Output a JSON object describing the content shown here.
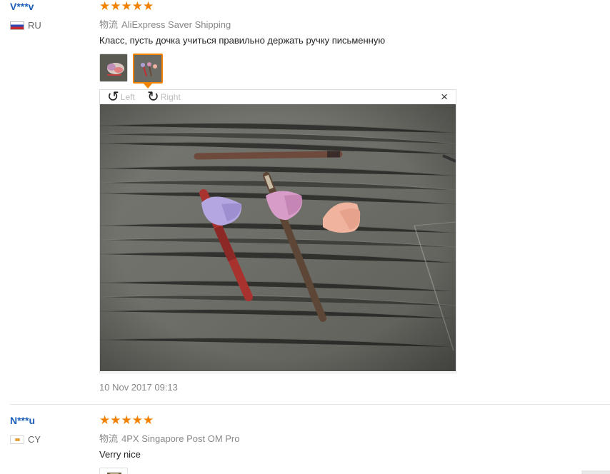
{
  "reviews": [
    {
      "user": "V***v",
      "country": "RU",
      "stars": "★★★★★",
      "rating": 5,
      "shipping_label": "物流",
      "shipping": "AliExpress Saver Shipping",
      "text": "Класс, пусть дочка учиться правильно держать ручку письменную",
      "viewer": {
        "left_label": "Left",
        "right_label": "Right",
        "close": "×"
      },
      "date": "10 Nov 2017 09:13"
    },
    {
      "user": "N***u",
      "country": "CY",
      "stars": "★★★★★",
      "rating": 5,
      "shipping_label": "物流",
      "shipping": "4PX Singapore Post OM Pro",
      "text": "Verry nice"
    }
  ],
  "colors": {
    "accent": "#f08200",
    "user_link": "#1d5fb8"
  },
  "icons": [
    "rotate-left-icon",
    "rotate-right-icon",
    "close-icon",
    "star-icon"
  ]
}
